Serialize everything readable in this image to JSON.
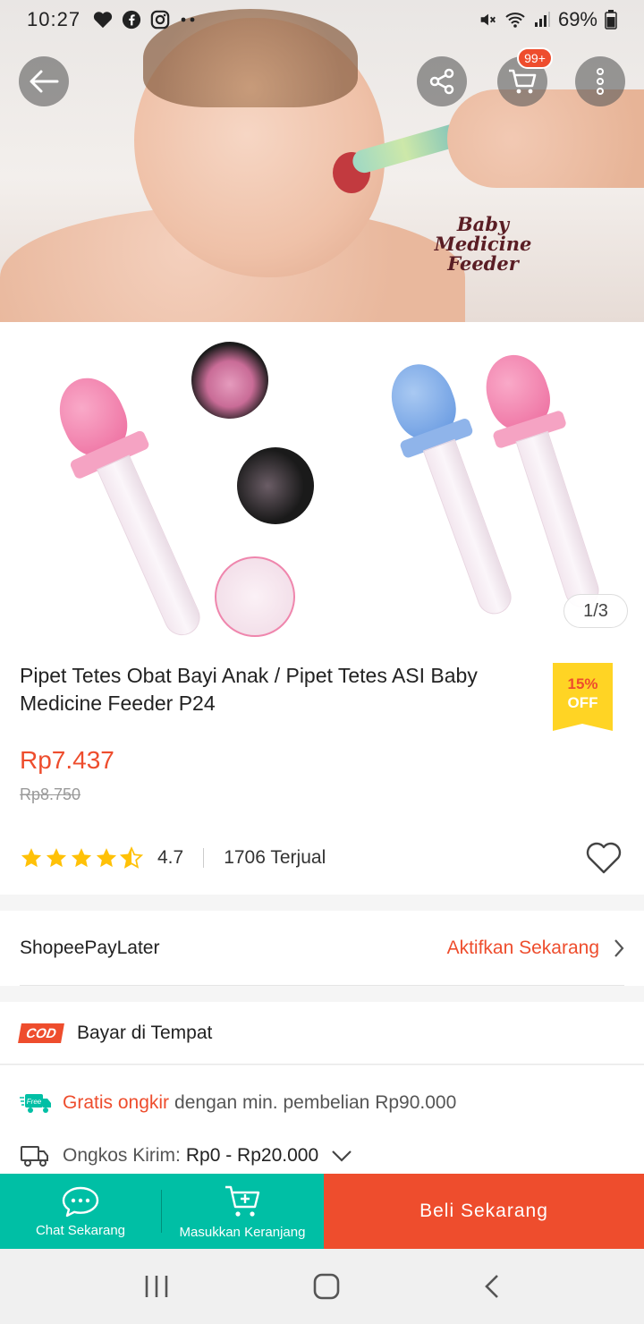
{
  "status_bar": {
    "time": "10:27",
    "battery": "69%",
    "icons": [
      "heart-icon",
      "facebook-icon",
      "instagram-icon",
      "more-dots-icon",
      "mute-icon",
      "wifi-icon",
      "signal-icon",
      "battery-icon"
    ]
  },
  "top_bar": {
    "cart_badge": "99+",
    "icons": [
      "back-arrow-icon",
      "share-icon",
      "cart-icon",
      "more-vertical-icon"
    ]
  },
  "hero": {
    "caption_lines": [
      "Baby",
      "Medicine",
      "Feeder"
    ],
    "image_counter": "1/3"
  },
  "product": {
    "title": "Pipet Tetes Obat Bayi Anak / Pipet Tetes ASI Baby Medicine Feeder P24",
    "discount_pct": "15%",
    "discount_off": "OFF",
    "price": "Rp7.437",
    "original_price": "Rp8.750",
    "rating": "4.7",
    "rating_value": 4.7,
    "sold": "1706 Terjual"
  },
  "paylater": {
    "label": "ShopeePayLater",
    "action": "Aktifkan Sekarang"
  },
  "cod": {
    "logo": "COD",
    "label": "Bayar di Tempat"
  },
  "shipping": {
    "free_label": "Gratis ongkir",
    "free_desc": "dengan min. pembelian Rp90.000",
    "free_icon_text": "Free",
    "cost_label": "Ongkos Kirim:",
    "cost_value": "Rp0 - Rp20.000"
  },
  "actions": {
    "chat": "Chat Sekarang",
    "add_cart": "Masukkan Keranjang",
    "buy": "Beli Sekarang"
  },
  "colors": {
    "accent": "#ee4d2d",
    "teal": "#00bfa5",
    "discount_bg": "#ffd424",
    "star": "#ffc107"
  }
}
